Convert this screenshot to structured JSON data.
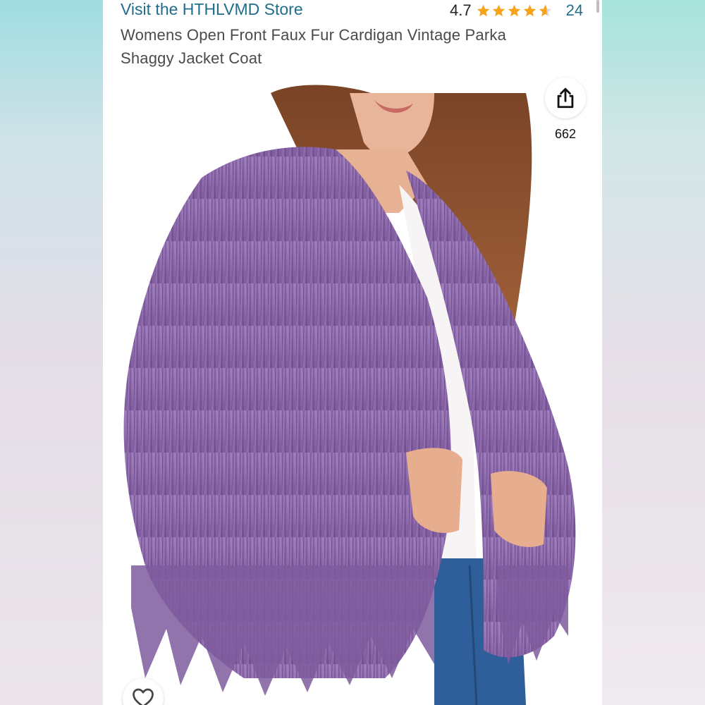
{
  "store": {
    "link_text": "Visit the HTHLVMD Store"
  },
  "rating": {
    "value": "4.7",
    "stars": 4.7,
    "count": "24"
  },
  "product": {
    "title": "Womens Open Front Faux Fur Cardigan Vintage Parka Shaggy Jacket Coat"
  },
  "share": {
    "icon": "share-icon",
    "count": "662"
  },
  "wishlist": {
    "icon": "heart-icon"
  },
  "colors": {
    "link": "#1f6e8c",
    "star": "#f7a31c",
    "fur": "#8a66a8"
  }
}
